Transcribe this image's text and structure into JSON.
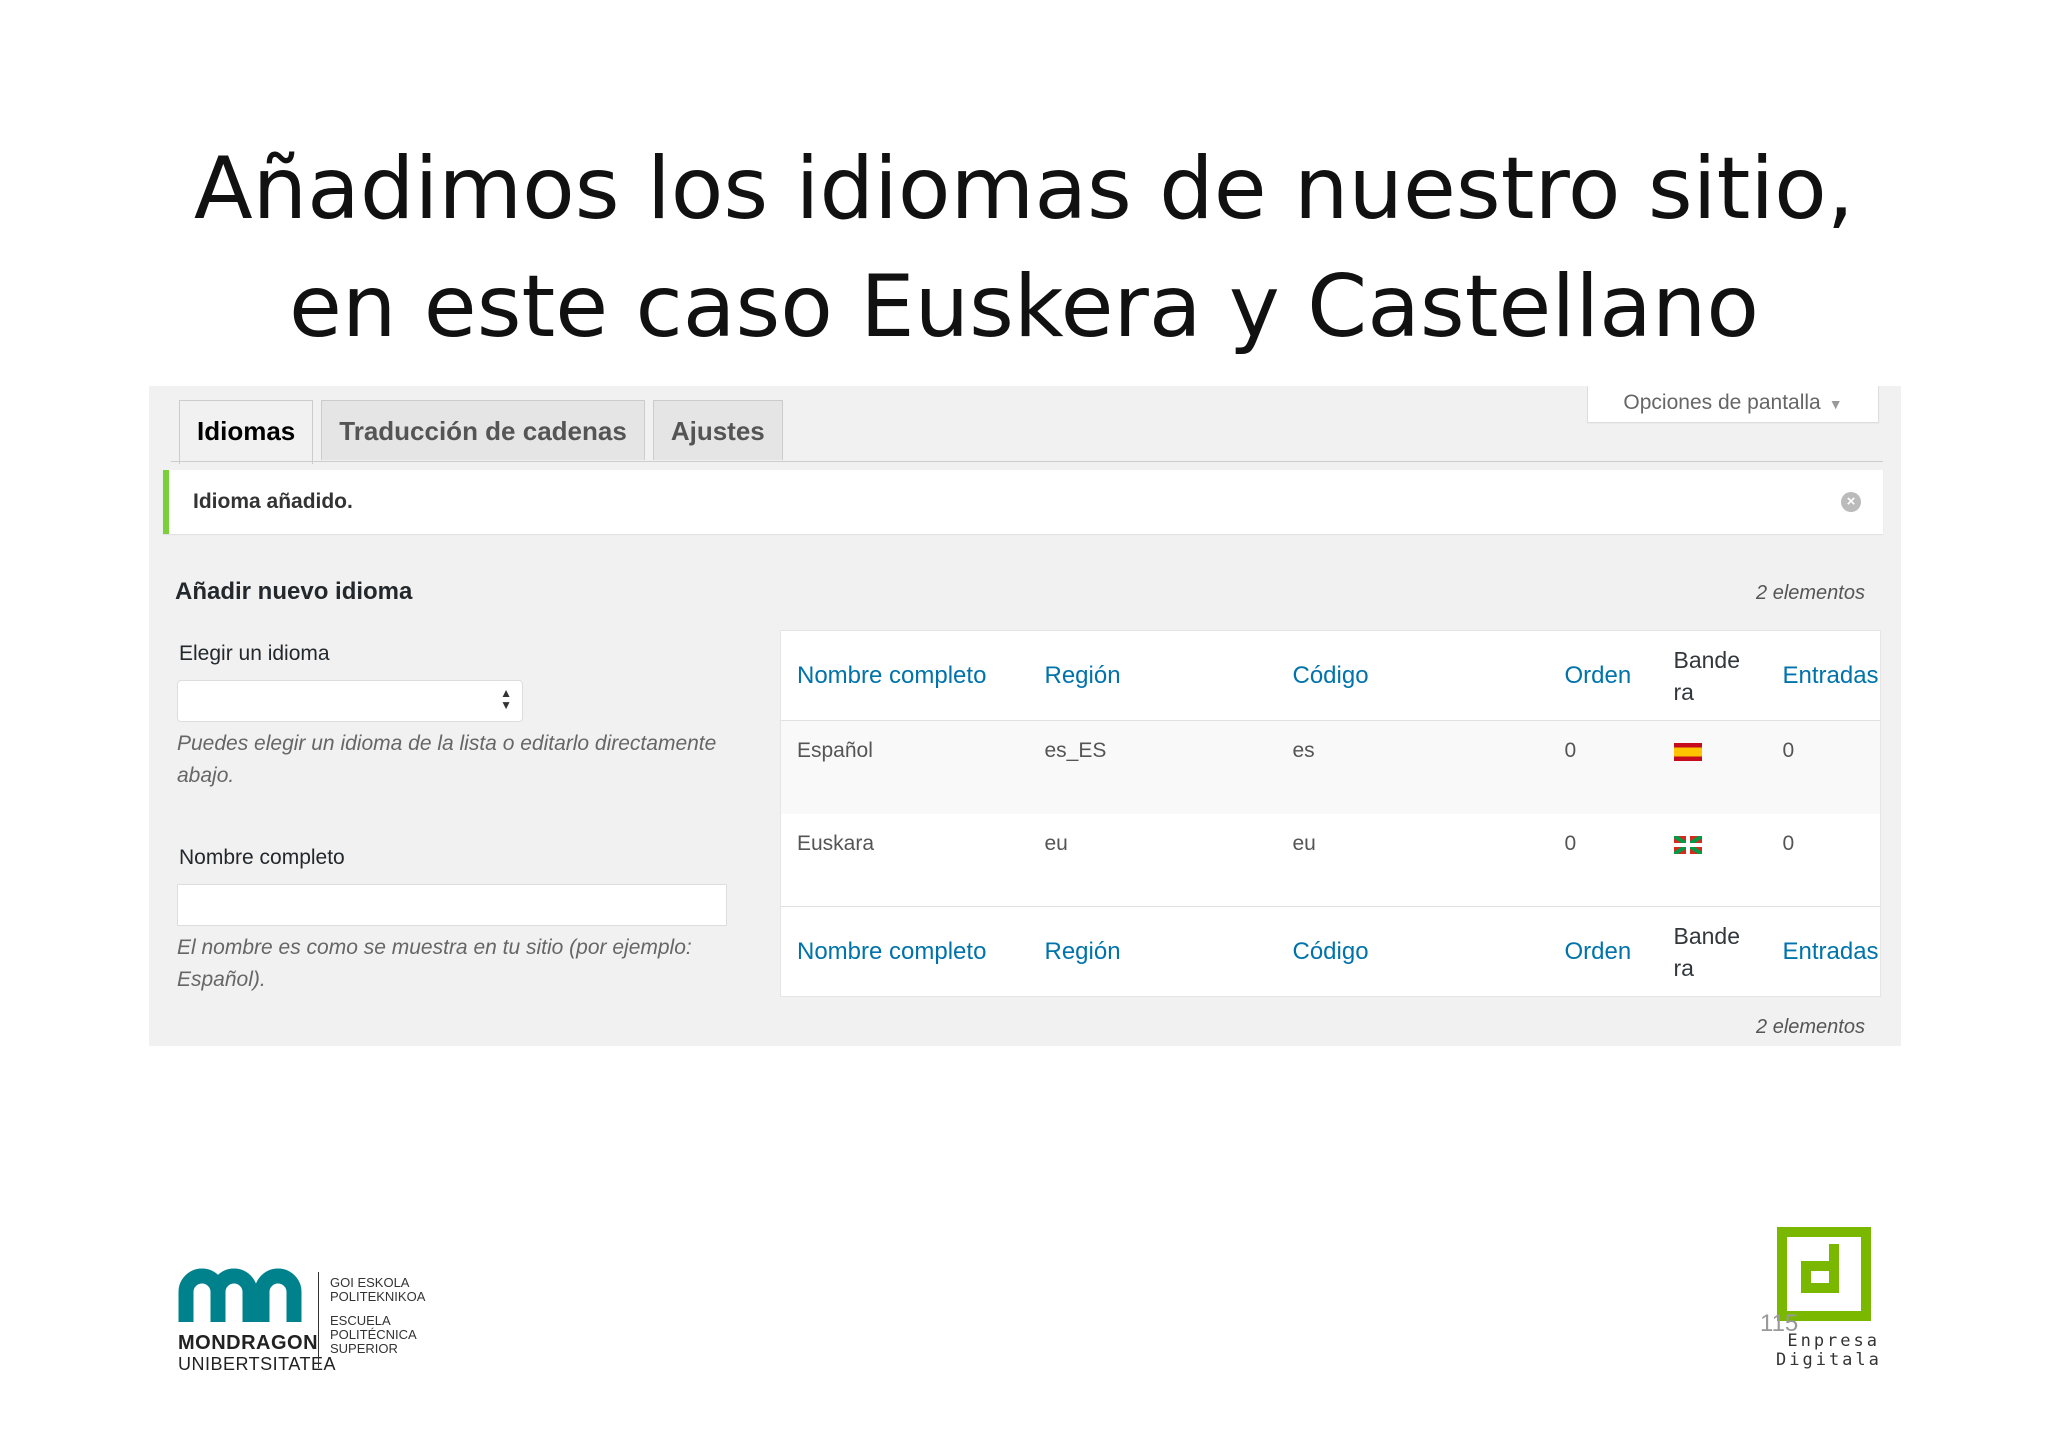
{
  "slide": {
    "title_line1": "Añadimos los idiomas de nuestro sitio,",
    "title_line2": "en este caso Euskera y Castellano",
    "page_number": "115"
  },
  "screen_options": {
    "label": "Opciones de pantalla"
  },
  "tabs": [
    {
      "label": "Idiomas",
      "active": true
    },
    {
      "label": "Traducción de cadenas",
      "active": false
    },
    {
      "label": "Ajustes",
      "active": false
    }
  ],
  "notice": {
    "text": "Idioma añadido.",
    "color": "#7ad03a"
  },
  "form": {
    "title": "Añadir nuevo idioma",
    "select_label": "Elegir un idioma",
    "select_help": "Puedes elegir un idioma de la lista o editarlo directamente abajo.",
    "name_label": "Nombre completo",
    "name_help": "El nombre es como se muestra en tu sitio (por ejemplo: Español)."
  },
  "table": {
    "count": "2 elementos",
    "columns": [
      "Nombre completo",
      "Región",
      "Código",
      "Orden",
      "Bande ra",
      "Entradas"
    ],
    "rows": [
      {
        "name": "Español",
        "region": "es_ES",
        "code": "es",
        "order": "0",
        "flag": "flag-es",
        "posts": "0"
      },
      {
        "name": "Euskara",
        "region": "eu",
        "code": "eu",
        "order": "0",
        "flag": "flag-eu",
        "posts": "0"
      }
    ],
    "link_color": "#0073aa"
  },
  "footer": {
    "university_line1": "MONDRAGON",
    "university_line2": "UNIBERTSITATEA",
    "school_basque_1": "GOI ESKOLA",
    "school_basque_2": "POLITEKNIKOA",
    "school_spanish_1": "ESCUELA",
    "school_spanish_2": "POLITÉCNICA",
    "school_spanish_3": "SUPERIOR",
    "brand_line1": "Enpresa",
    "brand_line2": "Digitala",
    "university_color": "#00828c",
    "brand_color": "#7ab800"
  }
}
